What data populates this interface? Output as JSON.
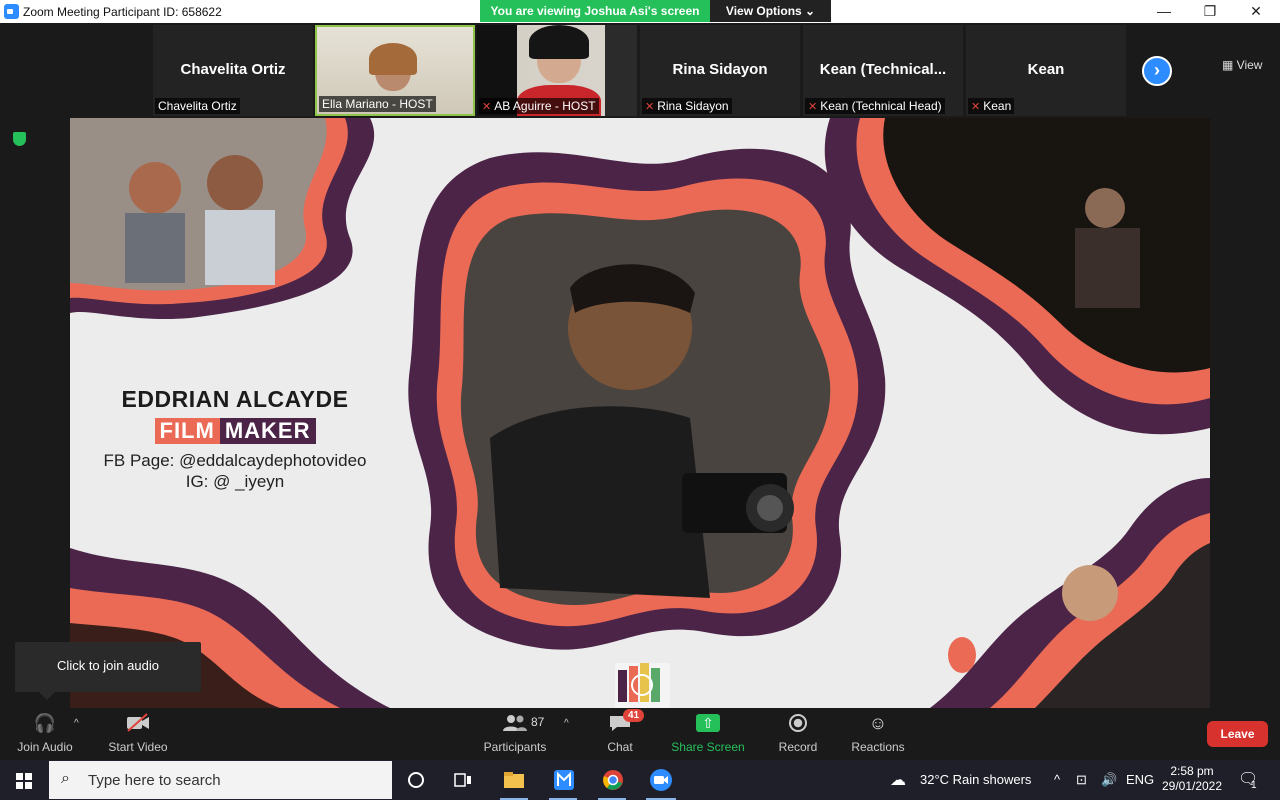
{
  "window": {
    "title": "Zoom Meeting Participant ID: 658622",
    "controls": {
      "minimize": "—",
      "restore": "❐",
      "close": "✕"
    }
  },
  "banner": {
    "viewing": "You are viewing Joshua Asi's screen",
    "view_options": "View Options ⌄"
  },
  "participants_strip": {
    "tiles": [
      {
        "big": "Chavelita Ortiz",
        "label": "Chavelita Ortiz",
        "muted": false
      },
      {
        "big": "",
        "label": "Ella Mariano - HOST",
        "muted": false
      },
      {
        "big": "",
        "label": "AB Aguirre - HOST",
        "muted": true
      },
      {
        "big": "Rina Sidayon",
        "label": "Rina Sidayon",
        "muted": true
      },
      {
        "big": "Kean  (Technical...",
        "label": "Kean (Technical Head)",
        "muted": true
      },
      {
        "big": "Kean",
        "label": "Kean",
        "muted": true
      }
    ],
    "next_arrow": "›",
    "view_label": "▦ View"
  },
  "slide": {
    "name": "EDDRIAN ALCAYDE",
    "badge_film": "FILM",
    "badge_maker": "MAKER",
    "fb": "FB Page: @eddalcaydephotovideo",
    "ig": "IG: @ _iyeyn"
  },
  "tooltip": {
    "join_audio": "Click to join audio"
  },
  "toolbar": {
    "join_audio": "Join Audio",
    "start_video": "Start Video",
    "participants": "Participants",
    "participants_count": "87",
    "chat": "Chat",
    "chat_badge": "41",
    "share_screen": "Share Screen",
    "record": "Record",
    "reactions": "Reactions",
    "leave": "Leave",
    "caret": "^"
  },
  "taskbar": {
    "search_placeholder": "Type here to search",
    "weather": "32°C  Rain showers",
    "lang": "ENG",
    "time": "2:58 pm",
    "date": "29/01/2022",
    "notification_count": "1"
  },
  "colors": {
    "zoom_blue": "#2d8cff",
    "share_green": "#25c05a",
    "leave_red": "#d7322d",
    "slide_purple": "#4b2448",
    "slide_coral": "#ea6a55"
  }
}
